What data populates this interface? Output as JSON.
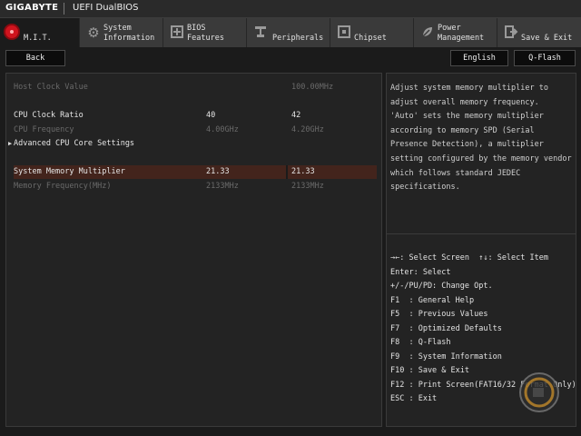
{
  "brand": {
    "logo": "GIGABYTE",
    "title": "UEFI DualBIOS"
  },
  "tabs": [
    {
      "label": "M.I.T.",
      "icon": "mit-red-dot-icon",
      "active": true
    },
    {
      "label": "System\nInformation",
      "icon": "gear-icon"
    },
    {
      "label": "BIOS\nFeatures",
      "icon": "bios-features-icon"
    },
    {
      "label": "Peripherals",
      "icon": "peripherals-icon"
    },
    {
      "label": "Chipset",
      "icon": "chipset-icon"
    },
    {
      "label": "Power\nManagement",
      "icon": "power-icon"
    },
    {
      "label": "Save & Exit",
      "icon": "exit-icon"
    }
  ],
  "subbar": {
    "back": "Back",
    "language": "English",
    "qflash": "Q-Flash"
  },
  "settings": [
    {
      "name": "Host Clock Value",
      "value1": "",
      "value2": "100.00MHz",
      "state": "dim"
    },
    {
      "name": "CPU Clock Ratio",
      "value1": "40",
      "value2": "42",
      "state": "normal"
    },
    {
      "name": "CPU Frequency",
      "value1": "4.00GHz",
      "value2": "4.20GHz",
      "state": "dim"
    },
    {
      "name": "Advanced CPU Core Settings",
      "value1": "",
      "value2": "",
      "state": "submenu"
    },
    {
      "name": "System Memory Multiplier",
      "value1": "21.33",
      "value2": "21.33",
      "state": "selected"
    },
    {
      "name": "Memory Frequency(MHz)",
      "value1": "2133MHz",
      "value2": "2133MHz",
      "state": "dim"
    }
  ],
  "help": {
    "description": "Adjust system memory multiplier to\nadjust overall memory frequency.\n'Auto' sets the memory multiplier\naccording to memory SPD (Serial\nPresence Detection), a multiplier\nsetting configured by the memory vendor\nwhich follows standard JEDEC\nspecifications."
  },
  "key_help": [
    "→←: Select Screen  ↑↓: Select Item",
    "Enter: Select",
    "+/-/PU/PD: Change Opt.",
    "F1  : General Help",
    "F5  : Previous Values",
    "F7  : Optimized Defaults",
    "F8  : Q-Flash",
    "F9  : System Information",
    "F10 : Save & Exit",
    "F12 : Print Screen(FAT16/32 Format Only)",
    "ESC : Exit"
  ],
  "colors": {
    "accent": "#d0141e",
    "selected_row": "#43241c",
    "background": "#1b1b1b"
  }
}
